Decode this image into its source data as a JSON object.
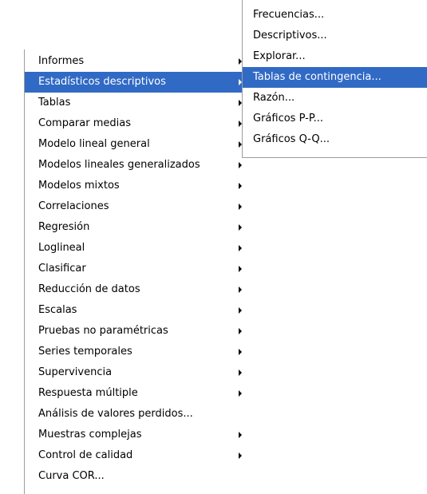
{
  "main_menu": {
    "items": [
      {
        "label": "Informes",
        "has_submenu": true
      },
      {
        "label": "Estadísticos descriptivos",
        "has_submenu": true,
        "selected": true
      },
      {
        "label": "Tablas",
        "has_submenu": true
      },
      {
        "label": "Comparar medias",
        "has_submenu": true
      },
      {
        "label": "Modelo lineal general",
        "has_submenu": true
      },
      {
        "label": "Modelos lineales generalizados",
        "has_submenu": true
      },
      {
        "label": "Modelos mixtos",
        "has_submenu": true
      },
      {
        "label": "Correlaciones",
        "has_submenu": true
      },
      {
        "label": "Regresión",
        "has_submenu": true
      },
      {
        "label": "Loglineal",
        "has_submenu": true
      },
      {
        "label": "Clasificar",
        "has_submenu": true
      },
      {
        "label": "Reducción de datos",
        "has_submenu": true
      },
      {
        "label": "Escalas",
        "has_submenu": true
      },
      {
        "label": "Pruebas no paramétricas",
        "has_submenu": true
      },
      {
        "label": "Series temporales",
        "has_submenu": true
      },
      {
        "label": "Supervivencia",
        "has_submenu": true
      },
      {
        "label": "Respuesta múltiple",
        "has_submenu": true
      },
      {
        "label": "Análisis de valores perdidos...",
        "has_submenu": false
      },
      {
        "label": "Muestras complejas",
        "has_submenu": true
      },
      {
        "label": "Control de calidad",
        "has_submenu": true
      },
      {
        "label": "Curva COR...",
        "has_submenu": false
      }
    ]
  },
  "sub_menu": {
    "items": [
      {
        "label": "Frecuencias..."
      },
      {
        "label": "Descriptivos..."
      },
      {
        "label": "Explorar..."
      },
      {
        "label": "Tablas de contingencia...",
        "selected": true
      },
      {
        "label": "Razón..."
      },
      {
        "label": "Gráficos P-P..."
      },
      {
        "label": "Gráficos Q-Q..."
      }
    ]
  },
  "colors": {
    "highlight": "#316ac5",
    "highlight_text": "#ffffff",
    "border": "#9d9d9d"
  }
}
